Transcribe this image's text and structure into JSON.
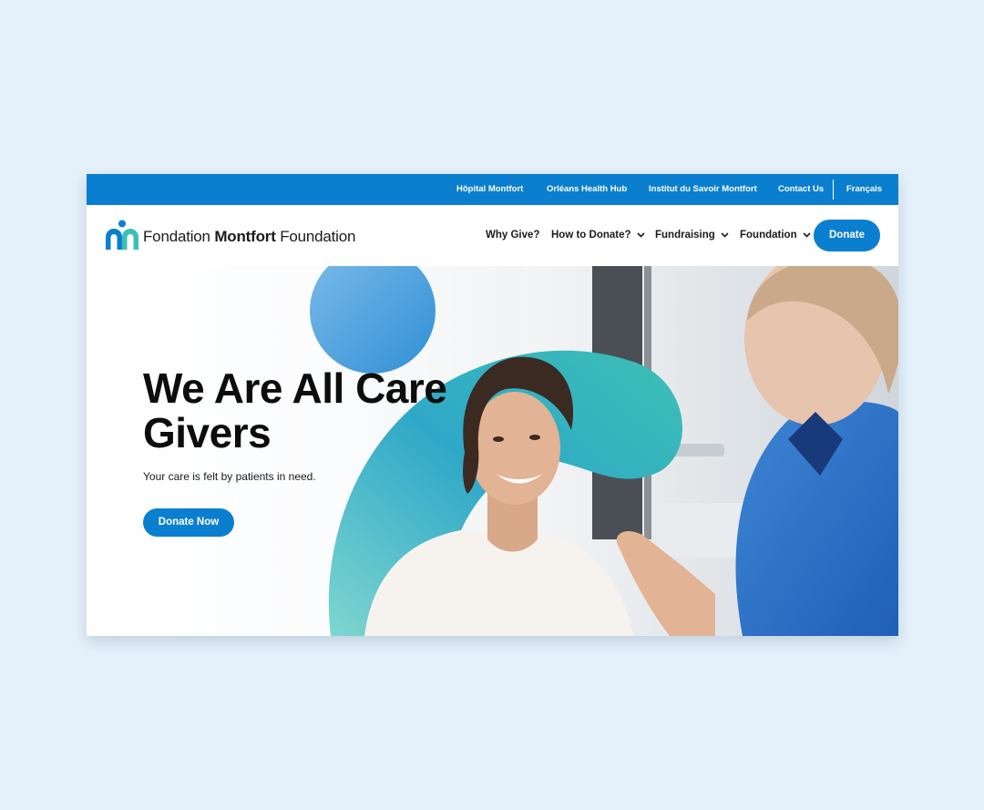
{
  "utility_nav": {
    "links": [
      "Hôpital Montfort",
      "Orléans Health Hub",
      "Institut du Savoir Montfort",
      "Contact Us"
    ],
    "language": "Français"
  },
  "logo": {
    "text_pre": "Fondation ",
    "text_bold": "Montfort",
    "text_post": " Foundation"
  },
  "main_nav": {
    "items": [
      "Why Give?",
      "How to Donate?",
      "Fundraising",
      "Foundation"
    ],
    "donate_label": "Donate"
  },
  "hero": {
    "title": "We Are All Care Givers",
    "subtitle": "Your care is felt by patients in need.",
    "cta_label": "Donate Now"
  },
  "colors": {
    "brand_blue": "#0b7fcf",
    "teal_accent": "#3cc0b4",
    "page_background": "#e4f0fa"
  }
}
